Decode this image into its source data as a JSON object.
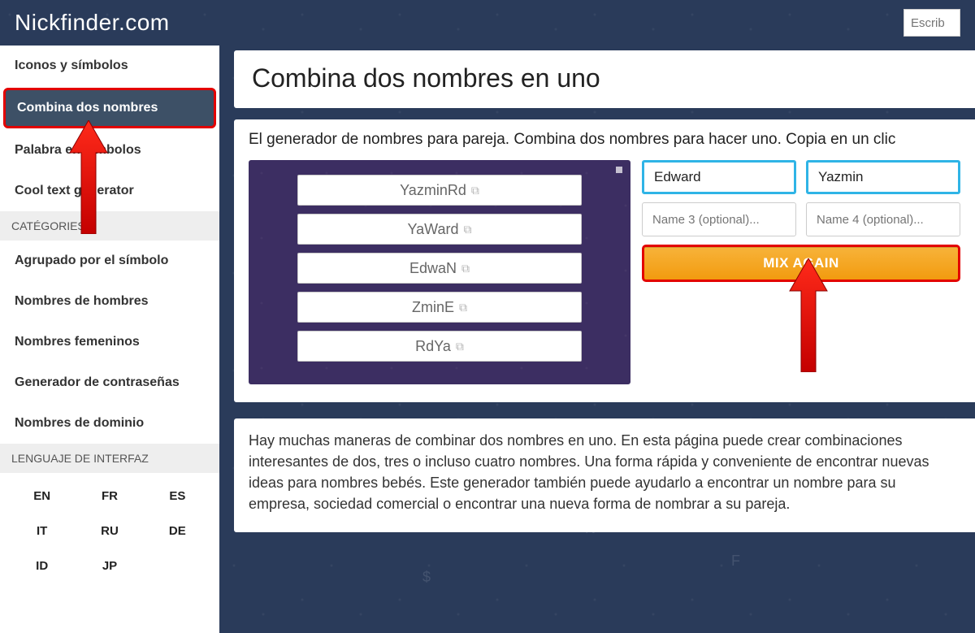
{
  "header": {
    "logo": "Nickfinder.com",
    "search_placeholder": "Escrib"
  },
  "sidebar": {
    "nav": [
      {
        "label": "Iconos y símbolos",
        "active": false
      },
      {
        "label": "Combina dos nombres",
        "active": true
      },
      {
        "label": "Palabra en símbolos",
        "active": false
      },
      {
        "label": "Cool text generator",
        "active": false
      }
    ],
    "categories_title": "CATÉGORIES",
    "categories": [
      "Agrupado por el símbolo",
      "Nombres de hombres",
      "Nombres femeninos",
      "Generador de contraseñas",
      "Nombres de dominio"
    ],
    "lang_title": "LENGUAJE DE INTERFAZ",
    "langs": [
      "EN",
      "FR",
      "ES",
      "IT",
      "RU",
      "DE",
      "ID",
      "JP"
    ]
  },
  "main": {
    "title": "Combina dos nombres en uno",
    "subtitle": "El generador de nombres para pareja. Combina dos nombres para hacer uno. Copia en un clic",
    "results": [
      "YazminRd",
      "YaWard",
      "EdwaN",
      "ZminE",
      "RdYa"
    ],
    "inputs": {
      "name1": "Edward",
      "name2": "Yazmin",
      "name3_placeholder": "Name 3 (optional)...",
      "name4_placeholder": "Name 4 (optional)..."
    },
    "mix_button": "MIX AGAIN",
    "description": "Hay muchas maneras de combinar dos nombres en uno. En esta página puede crear combinaciones interesantes de dos, tres o incluso cuatro nombres. Una forma rápida y conveniente de encontrar nuevas ideas para nombres bebés. Este generador también puede ayudarlo a encontrar un nombre para su empresa, sociedad comercial o encontrar una nueva forma de nombrar a su pareja."
  }
}
